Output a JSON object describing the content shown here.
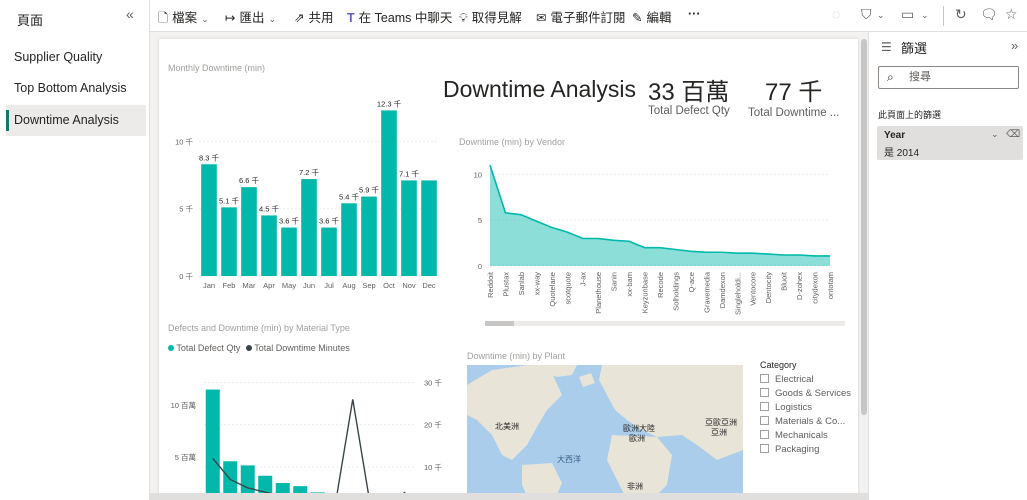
{
  "pages_pane": {
    "title": "頁面",
    "collapse_icon": "double-chevron-left-icon",
    "items": [
      {
        "label": "Supplier Quality"
      },
      {
        "label": "Top Bottom Analysis"
      },
      {
        "label": "Downtime Analysis",
        "active": true
      }
    ]
  },
  "toolbar": {
    "file": "檔案",
    "export": "匯出",
    "share": "共用",
    "teams": "在 Teams 中聊天",
    "insights": "取得見解",
    "subscribe": "電子郵件訂閱",
    "edit": "編輯",
    "more": "···"
  },
  "report": {
    "title": "Downtime Analysis",
    "kpi1": {
      "value": "33 百萬",
      "label": "Total Defect Qty"
    },
    "kpi2": {
      "value": "77 千",
      "label": "Total Downtime ..."
    },
    "monthly_title": "Monthly Downtime (min)",
    "vendor_title": "Downtime (min) by Vendor",
    "material_title": "Defects and Downtime (min) by Material Type",
    "material_legend": [
      "Total Defect Qty",
      "Total Downtime Minutes"
    ],
    "plant_title": "Downtime (min) by Plant",
    "map_labels": {
      "na": "北美洲",
      "atlantic": "大西洋",
      "eurasia_1": "歐洲大陸",
      "eurasia_2": "歐洲",
      "asia_1": "亞歐亞洲",
      "asia_2": "亞洲",
      "africa": "非洲"
    },
    "category": {
      "title": "Category",
      "items": [
        "Electrical",
        "Goods & Services",
        "Logistics",
        "Materials & Co...",
        "Mechanicals",
        "Packaging"
      ]
    }
  },
  "filters": {
    "title": "篩選",
    "search_placeholder": "搜尋",
    "section": "此頁面上的篩選",
    "card": {
      "name": "Year",
      "value": "是 2014"
    }
  },
  "colors": {
    "accent": "#01B8AA",
    "dark": "#374649",
    "active_bar": "#117865"
  },
  "chart_data": [
    {
      "type": "bar",
      "title": "Monthly Downtime (min)",
      "categories": [
        "Jan",
        "Feb",
        "Mar",
        "Apr",
        "May",
        "Jun",
        "Jul",
        "Aug",
        "Sep",
        "Oct",
        "Nov",
        "Dec"
      ],
      "values": [
        8.3,
        5.1,
        6.6,
        4.5,
        3.6,
        7.2,
        3.6,
        5.4,
        5.9,
        12.3,
        7.1,
        7.1
      ],
      "data_labels": [
        "8.3 千",
        "5.1 千",
        "6.6 千",
        "4.5 千",
        "3.6 千",
        "7.2 千",
        "3.6 千",
        "5.4 千",
        "5.9 千",
        "12.3 千",
        "7.1 千",
        ""
      ],
      "yticks": [
        "0 千",
        "5 千",
        "10 千"
      ],
      "ylim": [
        0,
        13
      ]
    },
    {
      "type": "area",
      "title": "Downtime (min) by Vendor",
      "categories": [
        "Reddoit",
        "Plustax",
        "Sanlab",
        "xx-way",
        "Quotelane",
        "scotquote",
        "J-ax",
        "Planethouse",
        "Sanin",
        "xx-bam",
        "Keyzunbase",
        "Recode",
        "Solholdings",
        "Q-ace",
        "Gravemedia",
        "Damdexon",
        "Singleholdi...",
        "Ventocore",
        "Dentocity",
        "Bluoit",
        "D-zohex",
        "citydexon",
        "ontotam"
      ],
      "values": [
        11,
        5.8,
        5.6,
        4.9,
        4.2,
        3.7,
        3.0,
        3.0,
        2.8,
        2.7,
        2.0,
        2.0,
        1.8,
        1.6,
        1.5,
        1.5,
        1.4,
        1.4,
        1.3,
        1.2,
        1.2,
        1.1,
        1.1
      ],
      "yticks": [
        "0",
        "5",
        "10"
      ],
      "ylim": [
        0,
        12
      ]
    },
    {
      "type": "bar",
      "title": "Defects and Downtime (min) by Material Type",
      "series": [
        {
          "name": "Total Defect Qty",
          "values": [
            11.5,
            4.6,
            4.2,
            3.2,
            2.5,
            2.2,
            1.6,
            1.4,
            1.0,
            0.9,
            0.5,
            0.4
          ]
        },
        {
          "name": "Total Downtime Minutes",
          "values": [
            12,
            7,
            5,
            4,
            3,
            2,
            1.5,
            1,
            26,
            1,
            1,
            4
          ]
        }
      ],
      "yticks_left": [
        "5 百萬",
        "10 百萬"
      ],
      "yticks_right": [
        "10 千",
        "20 千",
        "30 千"
      ]
    }
  ]
}
